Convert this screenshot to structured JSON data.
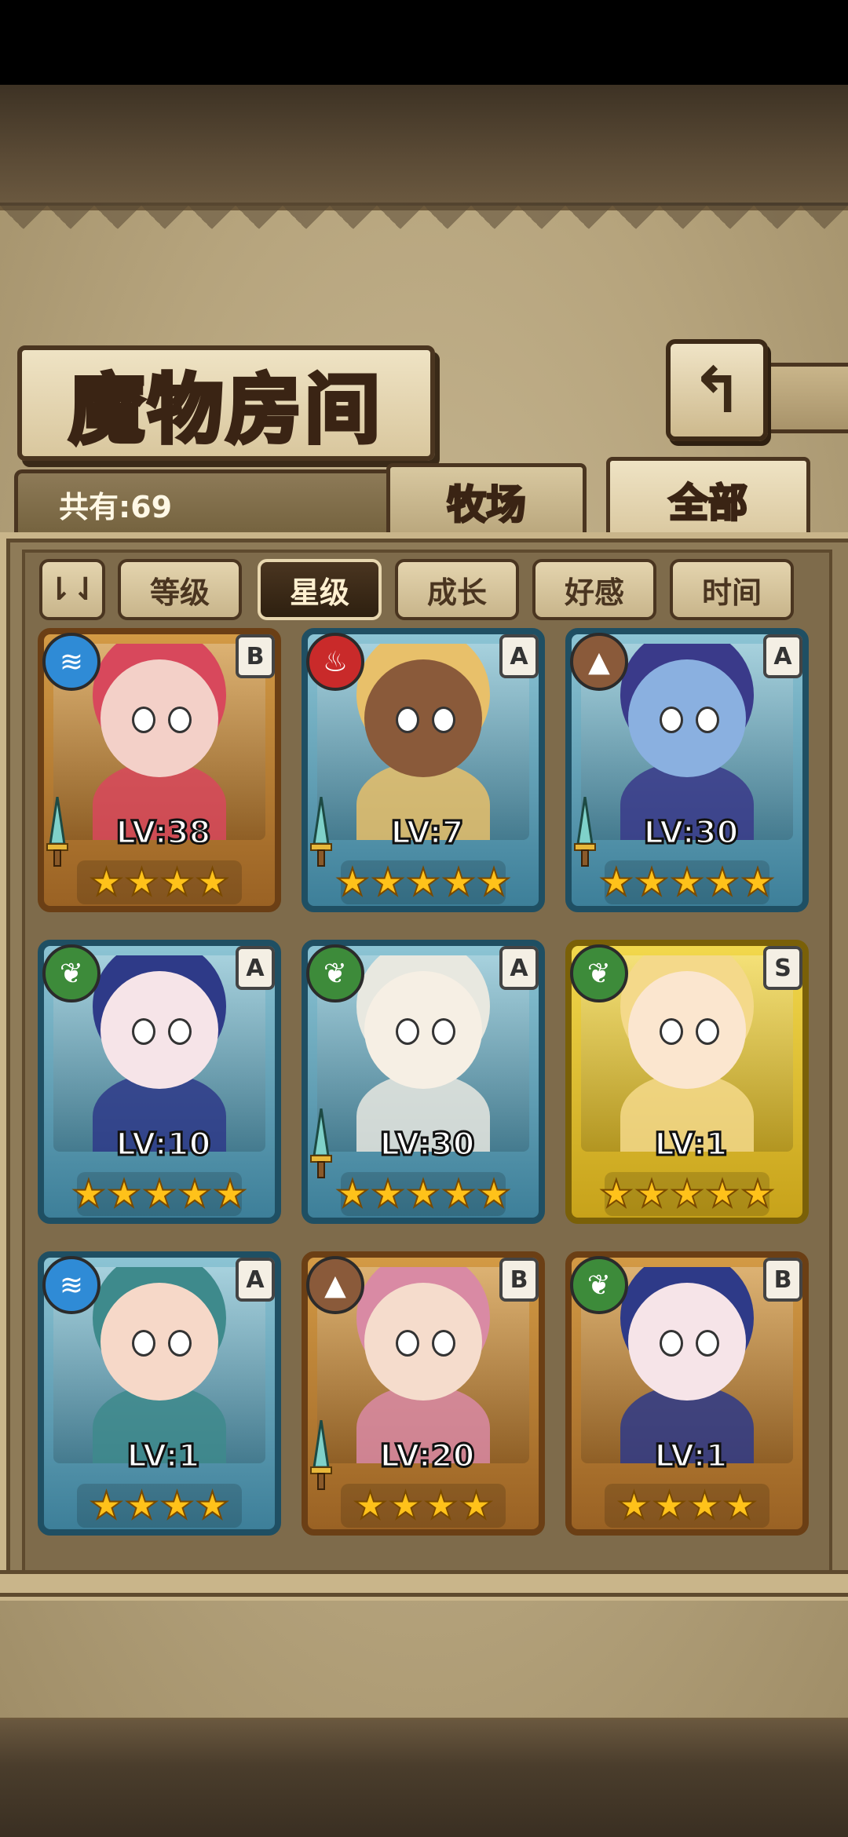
{
  "title": "魔物房间",
  "count_label": "共有:69",
  "tabs": [
    {
      "label": "牧场",
      "active": false
    },
    {
      "label": "全部",
      "active": true
    }
  ],
  "sort_buttons": [
    {
      "label": "等级",
      "active": false
    },
    {
      "label": "星级",
      "active": true
    },
    {
      "label": "成长",
      "active": false
    },
    {
      "label": "好感",
      "active": false
    },
    {
      "label": "时间",
      "active": false
    }
  ],
  "order_toggle_label": "⇂⇃",
  "back_icon": "↰",
  "monsters": [
    {
      "level": "LV:38",
      "rank": "B",
      "element": "water",
      "frame": "gold",
      "stars": 4,
      "has_sword": true,
      "hair": "#d8485c",
      "skin": "#f3d0c8"
    },
    {
      "level": "LV:7",
      "rank": "A",
      "element": "fire",
      "frame": "blue",
      "stars": 5,
      "has_sword": true,
      "hair": "#e8c06a",
      "skin": "#8a5a3a"
    },
    {
      "level": "LV:30",
      "rank": "A",
      "element": "earth",
      "frame": "blue",
      "stars": 5,
      "has_sword": true,
      "hair": "#3a3a8a",
      "skin": "#8ab0e0"
    },
    {
      "level": "LV:10",
      "rank": "A",
      "element": "wood",
      "frame": "blue",
      "stars": 5,
      "has_sword": false,
      "hair": "#2e3a88",
      "skin": "#f6e4e8"
    },
    {
      "level": "LV:30",
      "rank": "A",
      "element": "wood",
      "frame": "blue",
      "stars": 5,
      "has_sword": true,
      "hair": "#e8e8e0",
      "skin": "#f6efe4"
    },
    {
      "level": "LV:1",
      "rank": "S",
      "element": "wood",
      "frame": "yellow",
      "stars": 5,
      "has_sword": false,
      "hair": "#f4d98a",
      "skin": "#fbe6cf"
    },
    {
      "level": "LV:1",
      "rank": "A",
      "element": "water",
      "frame": "blue",
      "stars": 4,
      "has_sword": false,
      "hair": "#3e8a8c",
      "skin": "#f6d8c8"
    },
    {
      "level": "LV:20",
      "rank": "B",
      "element": "earth",
      "frame": "gold",
      "stars": 4,
      "has_sword": true,
      "hair": "#d98aa4",
      "skin": "#f5dccc"
    },
    {
      "level": "LV:1",
      "rank": "B",
      "element": "wood",
      "frame": "gold",
      "stars": 4,
      "has_sword": false,
      "hair": "#2e3a88",
      "skin": "#f6e4e8"
    }
  ],
  "element_icons": {
    "water": "≋",
    "fire": "♨",
    "earth": "▲",
    "wood": "❦"
  },
  "star_glyph": "★"
}
